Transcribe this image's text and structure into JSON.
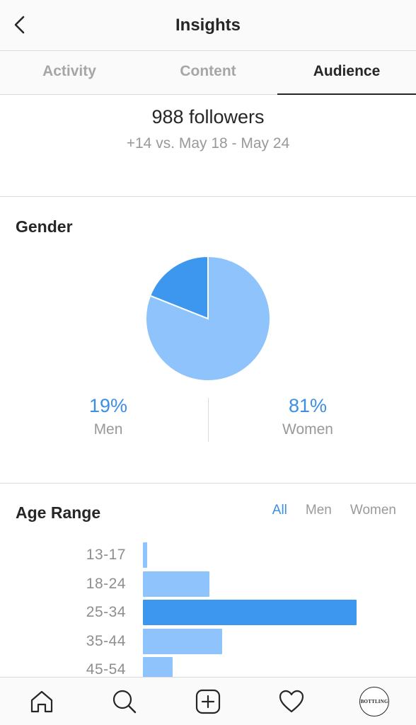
{
  "header": {
    "title": "Insights",
    "back_icon": "chevron-left-icon"
  },
  "tabs": [
    {
      "label": "Activity",
      "active": false
    },
    {
      "label": "Content",
      "active": false
    },
    {
      "label": "Audience",
      "active": true
    }
  ],
  "followers": {
    "count_text": "988 followers",
    "change_text": "+14 vs. May 18 - May 24"
  },
  "gender": {
    "title": "Gender",
    "men": {
      "percent_text": "19%",
      "label": "Men",
      "value": 19,
      "color": "#3d97ee"
    },
    "women": {
      "percent_text": "81%",
      "label": "Women",
      "value": 81,
      "color": "#8ec4fb"
    }
  },
  "age_range": {
    "title": "Age Range",
    "filters": [
      {
        "label": "All",
        "active": true
      },
      {
        "label": "Men",
        "active": false
      },
      {
        "label": "Women",
        "active": false
      }
    ],
    "colors": {
      "highlight": "#3d97ee",
      "normal": "#8ec4fb"
    }
  },
  "chart_data": {
    "type": "bar",
    "orientation": "horizontal",
    "categories": [
      "13-17",
      "18-24",
      "25-34",
      "35-44",
      "45-54"
    ],
    "values": [
      2,
      31,
      100,
      37,
      14
    ],
    "highlight_index": 2,
    "xlim": [
      0,
      100
    ]
  },
  "bottom_nav": [
    {
      "name": "home-icon"
    },
    {
      "name": "search-icon"
    },
    {
      "name": "add-post-icon"
    },
    {
      "name": "heart-icon"
    },
    {
      "name": "profile-avatar",
      "logo_text": "BOTTLING"
    }
  ]
}
